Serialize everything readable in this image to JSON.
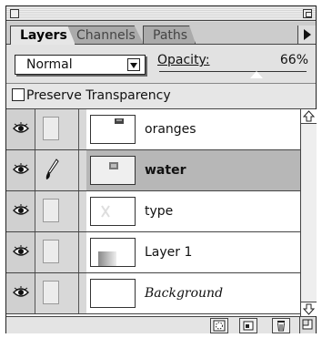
{
  "palette": {
    "tabs": [
      {
        "label": "Layers",
        "active": true
      },
      {
        "label": "Channels",
        "active": false
      },
      {
        "label": "Paths",
        "active": false
      }
    ],
    "blend_mode": "Normal",
    "opacity_label": "Opacity:",
    "opacity_value": "66%",
    "opacity_fraction": 0.66,
    "preserve_label": "Preserve Transparency",
    "preserve_checked": false,
    "layers": [
      {
        "name": "oranges",
        "visible": true,
        "brush": false,
        "selected": false,
        "style": "normal"
      },
      {
        "name": "water",
        "visible": true,
        "brush": true,
        "selected": true,
        "style": "bold"
      },
      {
        "name": "type",
        "visible": true,
        "brush": false,
        "selected": false,
        "style": "normal"
      },
      {
        "name": "Layer 1",
        "visible": true,
        "brush": false,
        "selected": false,
        "style": "normal"
      },
      {
        "name": "Background",
        "visible": true,
        "brush": false,
        "selected": false,
        "style": "italic"
      }
    ],
    "bottom_buttons": [
      "mask-icon",
      "new-layer-icon",
      "trash-icon"
    ],
    "icons": [
      "eye-icon",
      "brush-icon",
      "palette-menu-icon",
      "scroll-up-icon",
      "scroll-down-icon",
      "resize-icon"
    ]
  }
}
